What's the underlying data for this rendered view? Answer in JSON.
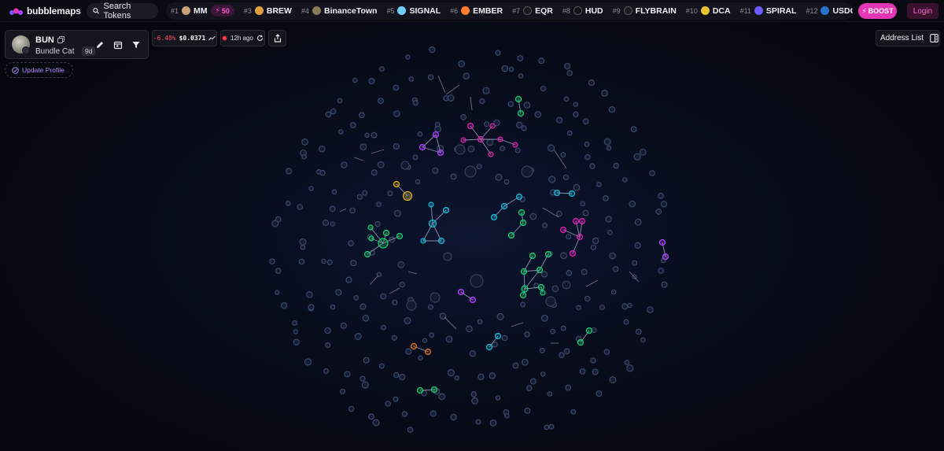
{
  "brand": {
    "name": "bubblemaps"
  },
  "search": {
    "label": "Search Tokens"
  },
  "ticker": [
    {
      "rank": "#1",
      "name": "MM",
      "icon_color": "#c9a27a",
      "boost": "50"
    },
    {
      "rank": "#3",
      "name": "BREW",
      "icon_color": "#e0a040"
    },
    {
      "rank": "#4",
      "name": "BinanceTown",
      "icon_color": "#8a7a5a"
    },
    {
      "rank": "#5",
      "name": "SIGNAL",
      "icon_color": "#6fd0ff"
    },
    {
      "rank": "#6",
      "name": "EMBER",
      "icon_color": "#ff7a2a"
    },
    {
      "rank": "#7",
      "name": "EQR",
      "icon_color": "#1a1a1a"
    },
    {
      "rank": "#8",
      "name": "HUD",
      "icon_color": "#111111"
    },
    {
      "rank": "#9",
      "name": "FLYBRAIN",
      "icon_color": "#1c1c1c"
    },
    {
      "rank": "#10",
      "name": "DCA",
      "icon_color": "#e8c030"
    },
    {
      "rank": "#11",
      "name": "SPIRAL",
      "icon_color": "#6a5cff"
    },
    {
      "rank": "#12",
      "name": "USDC",
      "icon_color": "#2775ca"
    }
  ],
  "header": {
    "boost_label": "BOOST",
    "login_label": "Login"
  },
  "token": {
    "symbol": "BUN",
    "name": "Bundle Cat",
    "age": "9d"
  },
  "profile": {
    "update_label": "Update Profile"
  },
  "price": {
    "change": "-6.48%",
    "value": "$0.0371"
  },
  "refresh": {
    "label": "12h ago"
  },
  "address_list": {
    "label": "Address List"
  },
  "colors": {
    "accent": "#e236b4",
    "bubble_default": "#3a4868",
    "magenta": "#e020b0",
    "purple": "#b040ff",
    "green": "#1ad070",
    "cyan": "#1ab8d8",
    "gold": "#e0b020",
    "orange": "#e07020"
  }
}
